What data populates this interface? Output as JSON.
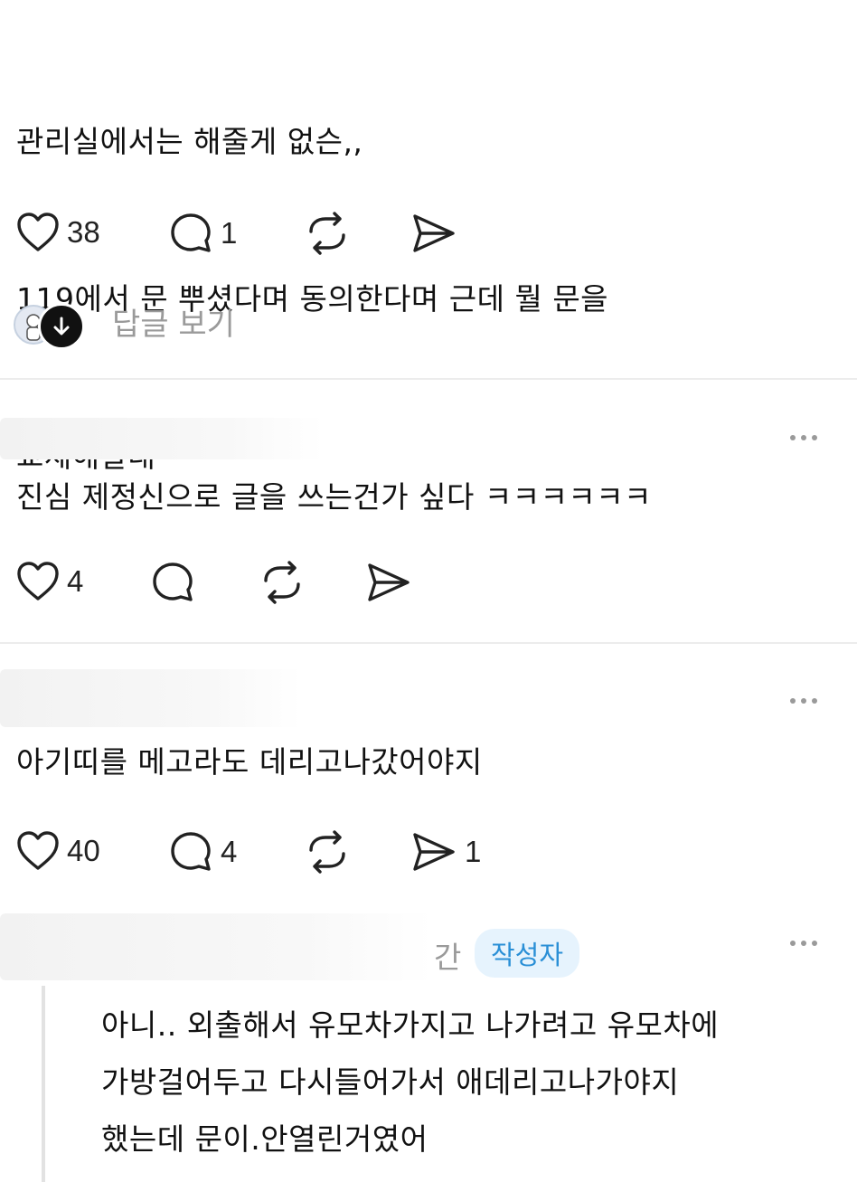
{
  "post1": {
    "lines": [
      "관리실에서는 해줄게 없슨,,",
      "119에서 문 뿌셨다며 동의한다며 근데 뭘 문을",
      "교체해달래"
    ],
    "likes": "38",
    "comments": "1",
    "view_replies": "답글 보기"
  },
  "post2": {
    "text": "진심 제정신으로 글을 쓰는건가 싶다 ㅋㅋㅋㅋㅋㅋ",
    "likes": "4"
  },
  "post3": {
    "text": "아기띠를 메고라도 데리고나갔어야지",
    "likes": "40",
    "comments": "4",
    "shares": "1"
  },
  "reply": {
    "time_partial": "간",
    "author_badge": "작성자",
    "lines": [
      "아니.. 외출해서 유모차가지고 나가려고 유모차에",
      "가방걸어두고 다시들어가서 애데리고나가야지",
      "했는데 문이.안열린거였어"
    ]
  },
  "colors": {
    "accent": "#2a8fd6",
    "badge_bg": "#e6f3fd",
    "muted": "#9a9a9a",
    "divider": "#ececec"
  },
  "icons": [
    "heart-icon",
    "comment-icon",
    "repost-icon",
    "share-icon",
    "more-icon",
    "arrow-down-icon"
  ]
}
